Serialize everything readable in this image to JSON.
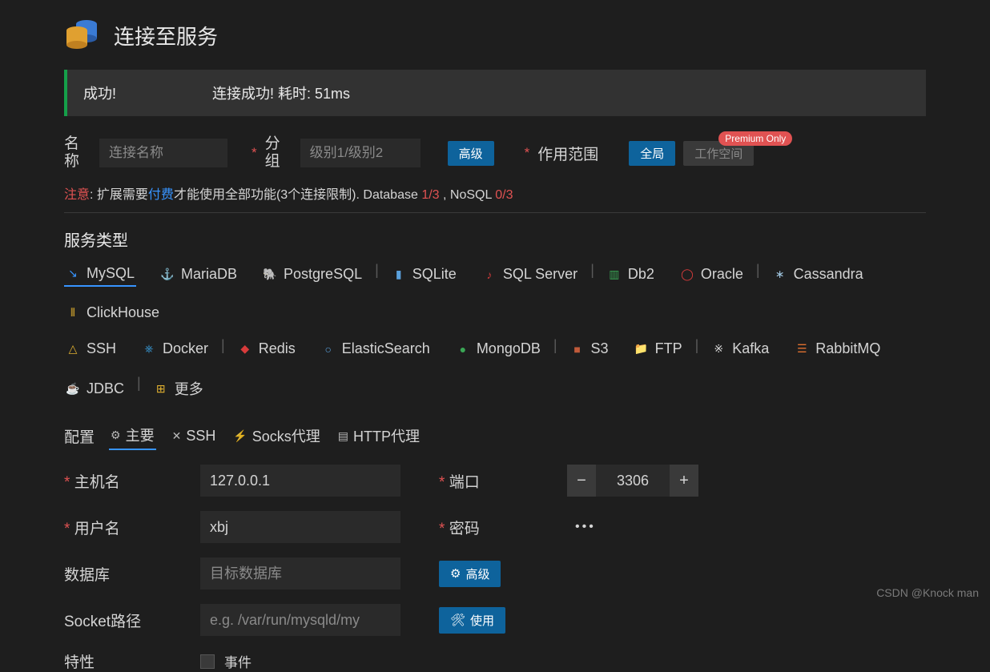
{
  "header": {
    "title": "连接至服务"
  },
  "status": {
    "label": "成功!",
    "message": "连接成功! 耗时: 51ms"
  },
  "nameRow": {
    "nameLabel": "名称",
    "namePlaceholder": "连接名称",
    "groupLabel": "分组",
    "groupPlaceholder": "级别1/级别2",
    "advancedBtn": "高级",
    "scopeLabel": "作用范围",
    "scopeGlobal": "全局",
    "scopeWorkspace": "工作空间",
    "premiumBadge": "Premium Only"
  },
  "notice": {
    "prefix": "注意",
    "part1": ": 扩展需要",
    "link": "付费",
    "part2": "才能使用全部功能(3个连接限制). Database ",
    "dbCount": "1/3",
    "sep": " , NoSQL ",
    "nosqlCount": "0/3"
  },
  "serviceSection": {
    "title": "服务类型"
  },
  "services": {
    "row1": [
      {
        "name": "MySQL",
        "active": true,
        "icon": "↘",
        "color": "#3794ff"
      },
      {
        "name": "MariaDB",
        "icon": "⚓",
        "color": "#6aa7d8"
      },
      {
        "name": "PostgreSQL",
        "icon": "🐘",
        "color": "#6a8fc7"
      },
      {
        "name": "SQLite",
        "sep": true,
        "icon": "▮",
        "color": "#5aa0dc"
      },
      {
        "name": "SQL Server",
        "icon": "♪",
        "color": "#cc3b3b"
      },
      {
        "name": "Db2",
        "sep": true,
        "icon": "▥",
        "color": "#3aa655"
      },
      {
        "name": "Oracle",
        "icon": "◯",
        "color": "#d83b3b"
      },
      {
        "name": "Cassandra",
        "sep": true,
        "icon": "∗",
        "color": "#a0c6e0"
      },
      {
        "name": "ClickHouse",
        "icon": "⦀",
        "color": "#e0b030"
      }
    ],
    "row2": [
      {
        "name": "SSH",
        "icon": "△",
        "color": "#e0b030"
      },
      {
        "name": "Docker",
        "icon": "⎈",
        "color": "#3aa0e0"
      },
      {
        "name": "Redis",
        "sep": true,
        "icon": "◆",
        "color": "#d83b3b"
      },
      {
        "name": "ElasticSearch",
        "icon": "○",
        "color": "#5aa0dc"
      },
      {
        "name": "MongoDB",
        "icon": "●",
        "color": "#3aa655"
      },
      {
        "name": "S3",
        "sep": true,
        "icon": "■",
        "color": "#c05a3a"
      },
      {
        "name": "FTP",
        "icon": "📁",
        "color": "#e0b030"
      },
      {
        "name": "Kafka",
        "sep": true,
        "icon": "※",
        "color": "#d4d4d4"
      },
      {
        "name": "RabbitMQ",
        "icon": "☰",
        "color": "#e07030"
      },
      {
        "name": "JDBC",
        "icon": "☕",
        "color": "#c0a070"
      },
      {
        "name": "更多",
        "sep": true,
        "icon": "⊞",
        "color": "#e0b030"
      }
    ]
  },
  "configTabs": {
    "label": "配置",
    "tabs": [
      {
        "id": "main",
        "label": "主要",
        "icon": "⚙",
        "active": true
      },
      {
        "id": "ssh",
        "label": "SSH",
        "icon": "✕"
      },
      {
        "id": "socks",
        "label": "Socks代理",
        "icon": "⚡"
      },
      {
        "id": "http",
        "label": "HTTP代理",
        "icon": "▤"
      }
    ]
  },
  "form": {
    "host": {
      "label": "主机名",
      "value": "127.0.0.1",
      "required": true
    },
    "port": {
      "label": "端口",
      "value": "3306",
      "required": true
    },
    "user": {
      "label": "用户名",
      "value": "xbj",
      "required": true
    },
    "password": {
      "label": "密码",
      "value": "•••",
      "required": true
    },
    "database": {
      "label": "数据库",
      "placeholder": "目标数据库",
      "btn": "高级"
    },
    "socket": {
      "label": "Socket路径",
      "placeholder": "e.g. /var/run/mysqld/my",
      "btn": "使用"
    },
    "feature": {
      "label": "特性",
      "checkLabel": "事件"
    }
  },
  "watermark": "CSDN @Knock man"
}
